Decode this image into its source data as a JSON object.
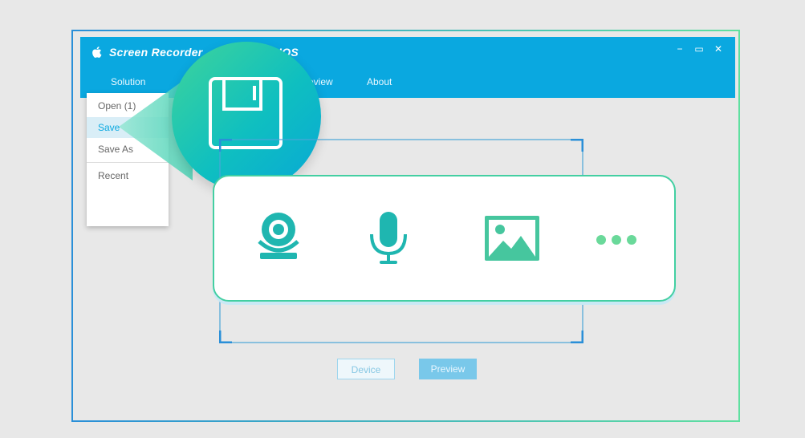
{
  "app": {
    "title": "Screen Recorder",
    "title_suffix": "IOS"
  },
  "window_controls": {
    "minimize": "−",
    "maximize": "▭",
    "close": "✕"
  },
  "menu": {
    "items": [
      "Solution",
      "Preview",
      "About"
    ]
  },
  "dropdown": {
    "items": [
      "Open  (1)",
      "Save",
      "Save As",
      "Recent"
    ],
    "active_index": 1
  },
  "buttons": {
    "device": "Device",
    "preview": "Preview"
  },
  "colors": {
    "brand": "#0aa8e0",
    "accent": "#1fc4b0",
    "green": "#5fe0a0"
  },
  "icons": [
    "apple-icon",
    "floppy-disk-icon",
    "webcam-icon",
    "microphone-icon",
    "image-icon",
    "more-dots-icon"
  ]
}
